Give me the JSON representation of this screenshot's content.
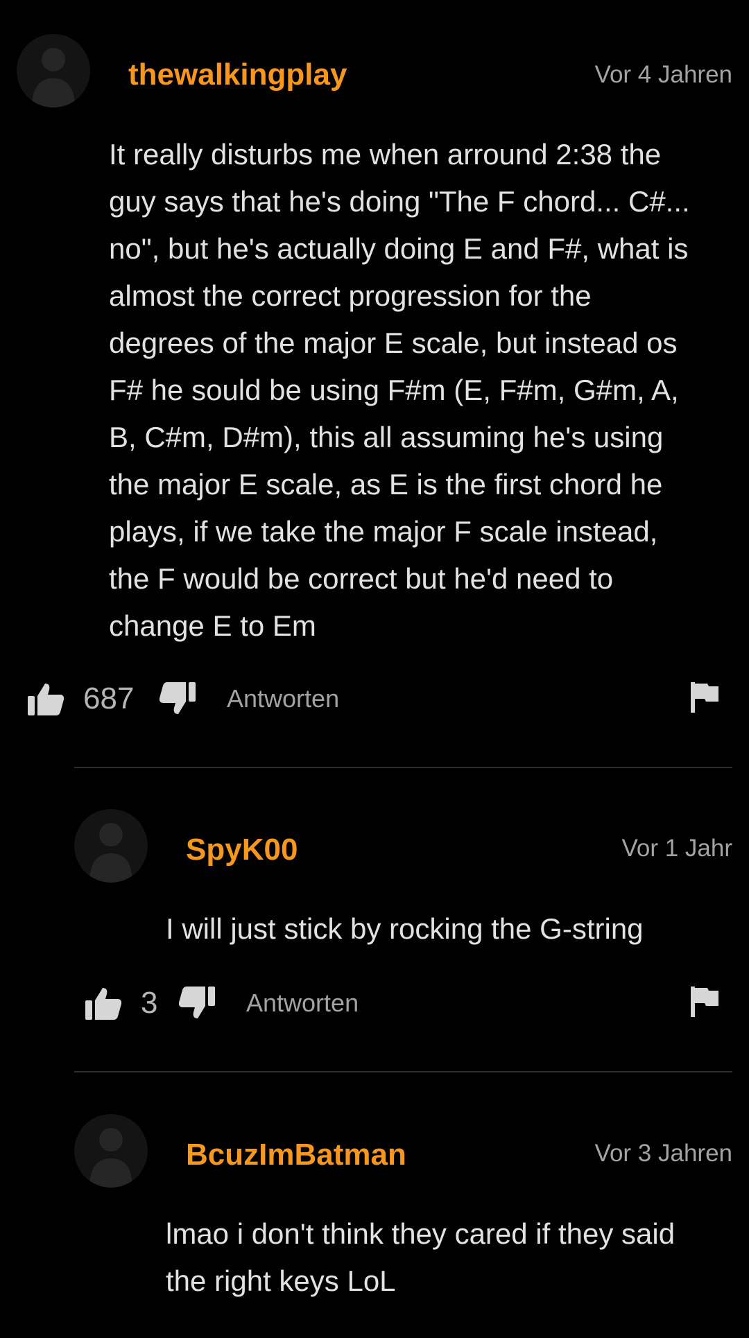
{
  "comments": [
    {
      "username": "thewalkingplay",
      "timestamp": "Vor 4 Jahren",
      "text": "It really disturbs me when arround 2:38 the\nguy says that he's doing \"The F chord... C#...\nno\", but he's actually doing E and F#, what is\nalmost the correct progression for the\ndegrees of the major E scale, but instead os\nF# he sould be using F#m (E, F#m, G#m, A,\nB, C#m, D#m), this all assuming he's using\nthe major E scale, as E is the first chord he\nplays, if we take the major F scale instead,\nthe F would be correct but he'd need to\nchange E to Em",
      "likes": "687",
      "reply_label": "Antworten"
    },
    {
      "username": "SpyK00",
      "timestamp": "Vor 1 Jahr",
      "text": "I will just stick by rocking the G-string",
      "likes": "3",
      "reply_label": "Antworten"
    },
    {
      "username": "BcuzImBatman",
      "timestamp": "Vor 3 Jahren",
      "text": "lmao i don't think they cared if they said\nthe right keys LoL"
    }
  ],
  "icons": {
    "avatar": "default-user-avatar-icon",
    "like": "thumbs-up-icon",
    "dislike": "thumbs-down-icon",
    "report": "flag-icon"
  },
  "colors": {
    "background": "#000000",
    "username": "#f7971d",
    "text": "#e2e2e2",
    "muted": "#a3a3a3",
    "icon": "#d6d6d6",
    "divider": "#2d2d2d"
  }
}
